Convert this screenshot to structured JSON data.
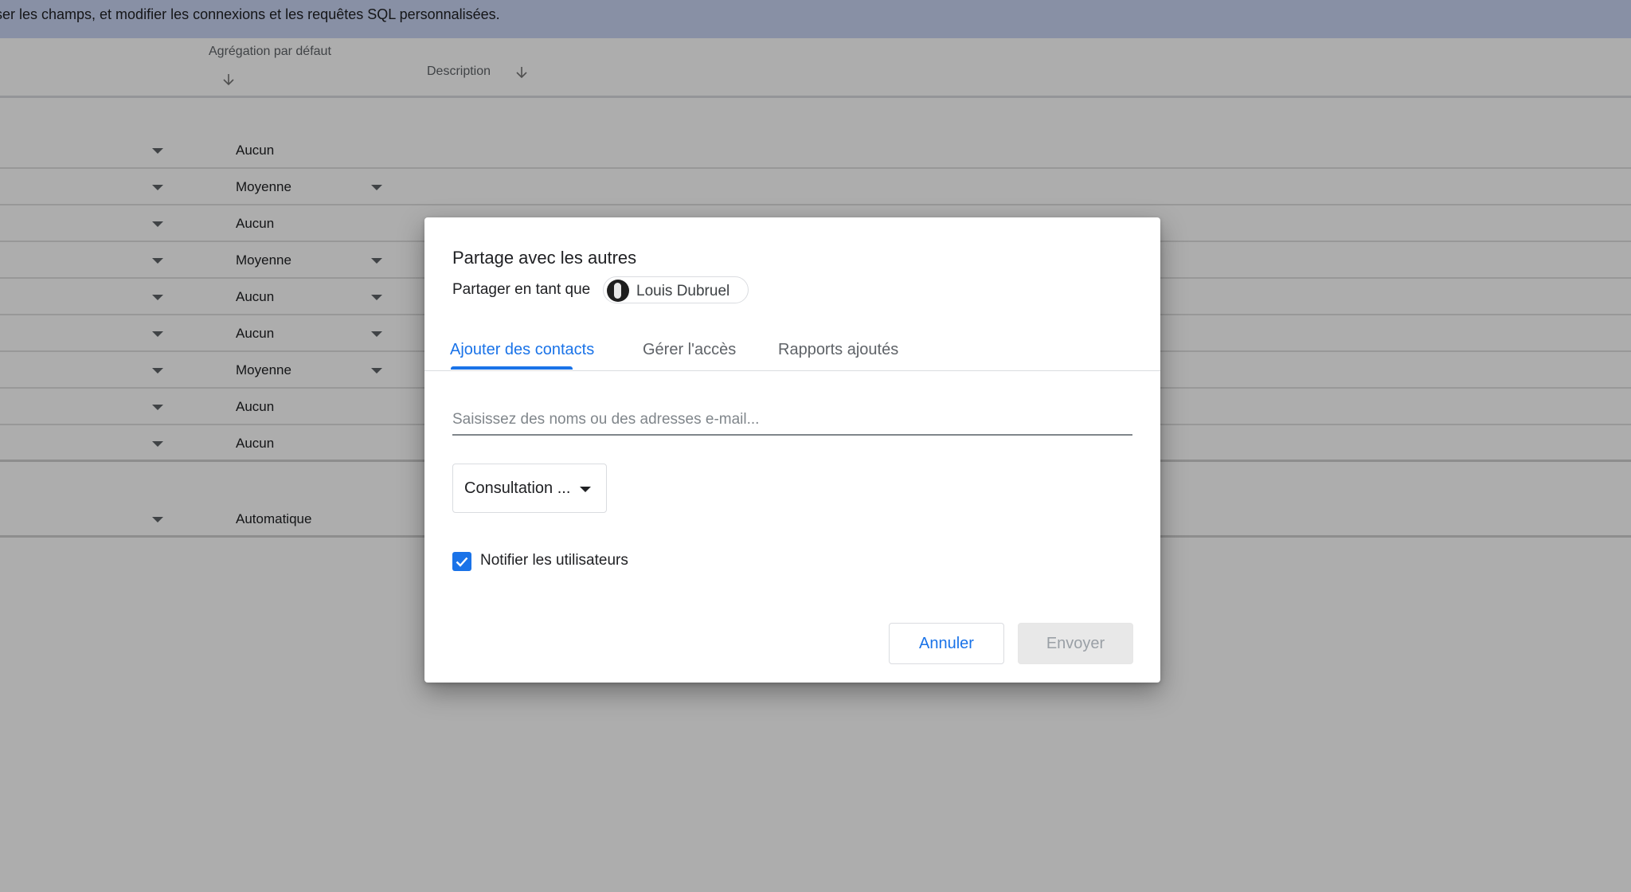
{
  "background": {
    "banner_text": "iser les champs, et modifier les connexions et les requêtes SQL personnalisées.",
    "columns": {
      "aggregation_header": "Agrégation par défaut",
      "description_header": "Description"
    },
    "rows": [
      {
        "aggregation": "Aucun",
        "has_caret": false
      },
      {
        "aggregation": "Moyenne",
        "has_caret": true
      },
      {
        "aggregation": "Aucun",
        "has_caret": false
      },
      {
        "aggregation": "Moyenne",
        "has_caret": true
      },
      {
        "aggregation": "Aucun",
        "has_caret": true
      },
      {
        "aggregation": "Aucun",
        "has_caret": true
      },
      {
        "aggregation": "Moyenne",
        "has_caret": true
      },
      {
        "aggregation": "Aucun",
        "has_caret": false
      },
      {
        "aggregation": "Aucun",
        "has_caret": false
      }
    ],
    "extra_row": {
      "aggregation": "Automatique"
    }
  },
  "dialog": {
    "title": "Partage avec les autres",
    "share_as_label": "Partager en tant que",
    "user_name": "Louis Dubruel",
    "tabs": [
      {
        "label": "Ajouter des contacts",
        "active": true
      },
      {
        "label": "Gérer l'accès",
        "active": false
      },
      {
        "label": "Rapports ajoutés",
        "active": false
      }
    ],
    "contact_input": {
      "value": "",
      "placeholder": "Saisissez des noms ou des adresses e-mail..."
    },
    "role_select": {
      "selected": "Consultation ..."
    },
    "notify": {
      "label": "Notifier les utilisateurs",
      "checked": true
    },
    "buttons": {
      "cancel": "Annuler",
      "send": "Envoyer"
    }
  },
  "colors": {
    "accent": "#1a73e8",
    "banner": "#c9d4f4",
    "disabled_button": "#e8e8e8"
  }
}
